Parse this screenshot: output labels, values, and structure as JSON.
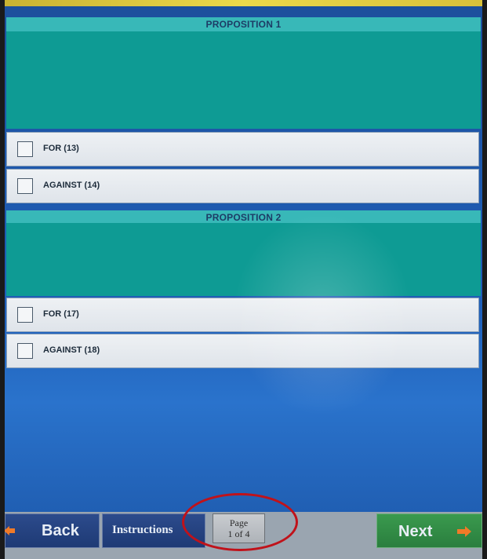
{
  "propositions": [
    {
      "title": "PROPOSITION 1",
      "options": [
        {
          "label": "FOR (13)"
        },
        {
          "label": "AGAINST (14)"
        }
      ]
    },
    {
      "title": "PROPOSITION 2",
      "options": [
        {
          "label": "FOR (17)"
        },
        {
          "label": "AGAINST (18)"
        }
      ]
    }
  ],
  "nav": {
    "back_label": "Back",
    "instructions_label": "Instructions",
    "page_label": "Page",
    "page_count": "1 of 4",
    "next_label": "Next"
  },
  "colors": {
    "header": "#38b8b8",
    "body": "#0e9b94",
    "background": "#1f5fb8",
    "next_button": "#2a7e3e",
    "arrow": "#f07a28",
    "annotation_circle": "#c0121a"
  },
  "icons": {
    "back": "arrow-left-icon",
    "next": "arrow-right-icon"
  }
}
